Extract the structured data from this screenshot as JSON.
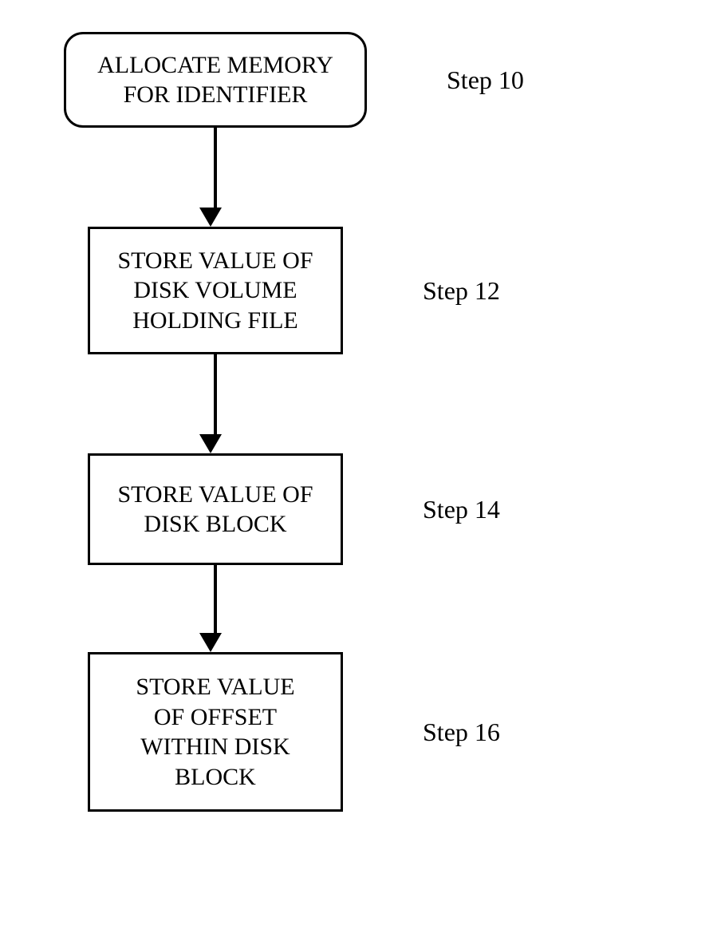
{
  "steps": [
    {
      "text": "ALLOCATE MEMORY\nFOR IDENTIFIER",
      "label": "Step 10"
    },
    {
      "text": "STORE VALUE OF\nDISK VOLUME\nHOLDING FILE",
      "label": "Step 12"
    },
    {
      "text": "STORE VALUE OF\nDISK BLOCK",
      "label": "Step 14"
    },
    {
      "text": "STORE VALUE\nOF OFFSET\nWITHIN DISK\nBLOCK",
      "label": "Step 16"
    }
  ]
}
